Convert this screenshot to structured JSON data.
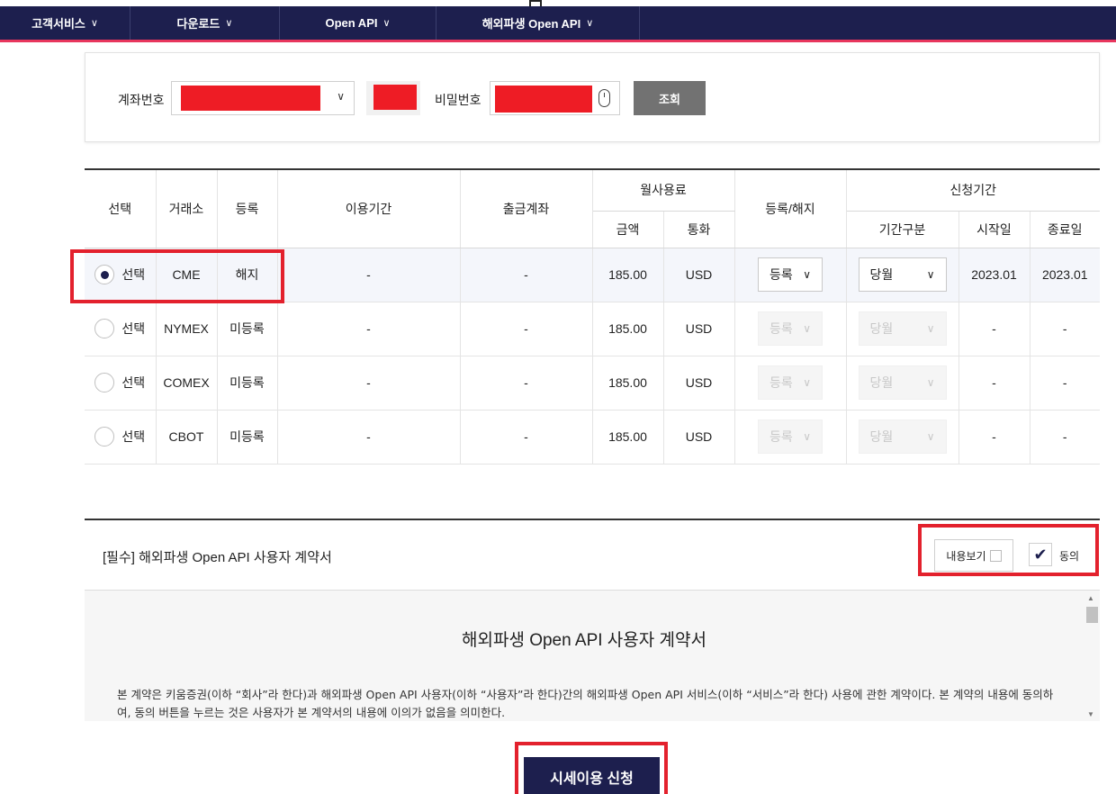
{
  "nav": {
    "items": [
      {
        "label": "고객서비스"
      },
      {
        "label": "다운로드"
      },
      {
        "label": "Open API"
      },
      {
        "label": "해외파생 Open API"
      }
    ]
  },
  "query": {
    "account_label": "계좌번호",
    "password_label": "비밀번호",
    "search_button": "조회"
  },
  "table": {
    "headers": {
      "select": "선택",
      "exchange": "거래소",
      "registration": "등록",
      "usage_period": "이용기간",
      "withdraw_account": "출금계좌",
      "monthly_fee": "월사용료",
      "amount": "금액",
      "currency": "통화",
      "register_cancel": "등록/해지",
      "apply_period": "신청기간",
      "period_type": "기간구분",
      "start": "시작일",
      "end": "종료일"
    },
    "rows": [
      {
        "select_label": "선택",
        "exchange": "CME",
        "status": "해지",
        "period": "-",
        "account": "-",
        "amount": "185.00",
        "currency": "USD",
        "action": "등록",
        "period_type": "당월",
        "start": "2023.01",
        "end": "2023.01"
      },
      {
        "select_label": "선택",
        "exchange": "NYMEX",
        "status": "미등록",
        "period": "-",
        "account": "-",
        "amount": "185.00",
        "currency": "USD",
        "action": "등록",
        "period_type": "당월",
        "start": "-",
        "end": "-"
      },
      {
        "select_label": "선택",
        "exchange": "COMEX",
        "status": "미등록",
        "period": "-",
        "account": "-",
        "amount": "185.00",
        "currency": "USD",
        "action": "등록",
        "period_type": "당월",
        "start": "-",
        "end": "-"
      },
      {
        "select_label": "선택",
        "exchange": "CBOT",
        "status": "미등록",
        "period": "-",
        "account": "-",
        "amount": "185.00",
        "currency": "USD",
        "action": "등록",
        "period_type": "당월",
        "start": "-",
        "end": "-"
      }
    ]
  },
  "agreement": {
    "section_title": "[필수] 해외파생 Open API 사용자 계약서",
    "view_button": "내용보기",
    "agree_label": "동의",
    "agree_checked": true,
    "doc_title": "해외파생 Open API 사용자 계약서",
    "doc_text": "본 계약은 키움증권(이하 “회사”라 한다)과 해외파생 Open API 사용자(이하 “사용자”라 한다)간의 해외파생 Open API 서비스(이하 “서비스”라 한다) 사용에 관한 계약이다. 본 계약의 내용에 동의하여, 동의 버튼을 누르는 것은 사용자가 본 계약서의 내용에 이의가 없음을 의미한다."
  },
  "submit_button": "시세이용 신청",
  "colors": {
    "navy": "#1d1f4e",
    "accent_pink": "#e8365d",
    "annotation_red": "#e3212d",
    "redaction_red": "#ee1c25"
  }
}
